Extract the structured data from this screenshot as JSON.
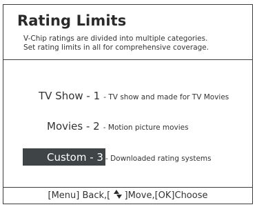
{
  "header": {
    "title": "Rating Limits",
    "description_line1": "V-Chip ratings are divided into multiple categories.",
    "description_line2": "Set rating limits in all for comprehensive coverage."
  },
  "menu": {
    "items": [
      {
        "label": "TV Show - 1",
        "description": "- TV show and made for TV Movies",
        "selected": false
      },
      {
        "label": "Movies - 2",
        "description": "- Motion picture movies",
        "selected": false
      },
      {
        "label": "Custom - 3",
        "description": "- Downloaded rating systems",
        "selected": true
      }
    ]
  },
  "footer": {
    "hint_before": "[Menu] Back,[ ",
    "arrow_icon": "up-down-arrows-icon",
    "hint_after": " ]Move,[OK]Choose"
  },
  "colors": {
    "highlight": "#3f4447",
    "border": "#3c3c3c",
    "text": "#333333"
  }
}
